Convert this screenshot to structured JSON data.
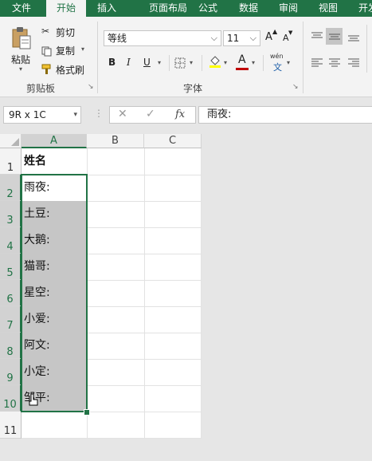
{
  "tabs": [
    "文件",
    "开始",
    "插入",
    "页面布局",
    "公式",
    "数据",
    "审阅",
    "视图",
    "开发"
  ],
  "ribbon": {
    "paste_label": "粘贴",
    "cut_label": "剪切",
    "copy_label": "复制",
    "format_painter_label": "格式刷",
    "clipboard_group": "剪贴板",
    "font_name": "等线",
    "font_size": "11",
    "bold": "B",
    "italic": "I",
    "underline": "U",
    "font_color_glyph": "A",
    "grow_font": "A",
    "shrink_font": "A",
    "wen_top": "wén",
    "wen_bottom": "文",
    "font_group": "字体"
  },
  "formula_bar": {
    "name_box": "9R x 1C",
    "cancel": "✕",
    "enter": "✓",
    "fx": "fx",
    "content": "雨夜:"
  },
  "sheet": {
    "columns": [
      "A",
      "B",
      "C"
    ],
    "rows": [
      "1",
      "2",
      "3",
      "4",
      "5",
      "6",
      "7",
      "8",
      "9",
      "10",
      "11"
    ],
    "header_cell": "姓名",
    "cells": [
      "雨夜:",
      "土豆:",
      "大鹅:",
      "猫哥:",
      "星空:",
      "小爱:",
      "阿文:",
      "小定:",
      "邹平:"
    ]
  },
  "colors": {
    "accent": "#217346",
    "selection_fill": "#c6c6c6"
  }
}
